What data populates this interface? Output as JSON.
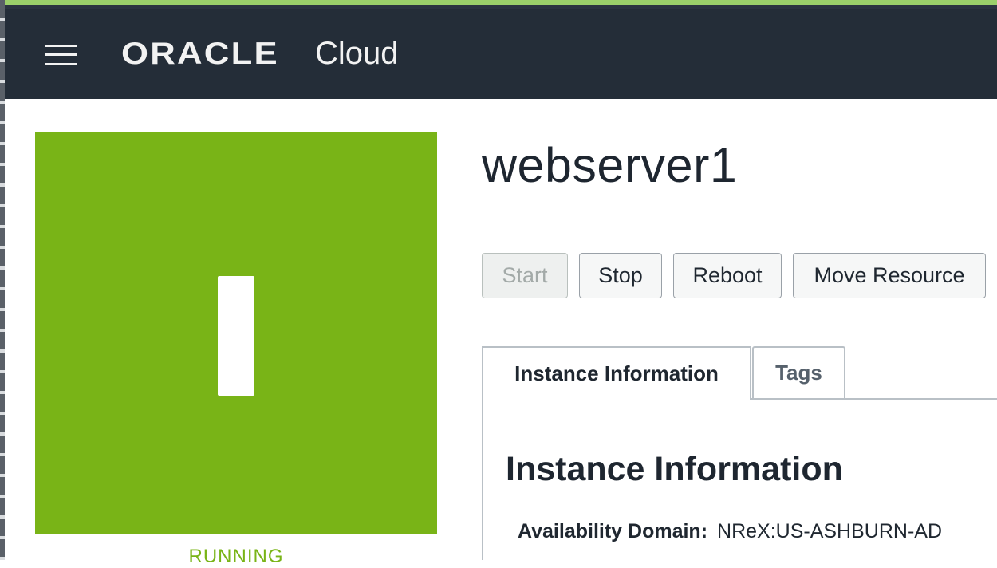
{
  "header": {
    "brand_oracle": "ORACLE",
    "brand_cloud": "Cloud",
    "menu_icon": "hamburger-menu-icon"
  },
  "instance": {
    "name": "webserver1",
    "status": "RUNNING",
    "status_color": "#79b417",
    "status_icon": "instance-letter-icon"
  },
  "actions": {
    "start": "Start",
    "stop": "Stop",
    "reboot": "Reboot",
    "move_resource": "Move Resource"
  },
  "tabs": [
    {
      "label": "Instance Information",
      "active": true
    },
    {
      "label": "Tags",
      "active": false
    }
  ],
  "info": {
    "section_title": "Instance Information",
    "availability_domain_label": "Availability Domain:",
    "availability_domain_value": "NReX:US-ASHBURN-AD"
  }
}
